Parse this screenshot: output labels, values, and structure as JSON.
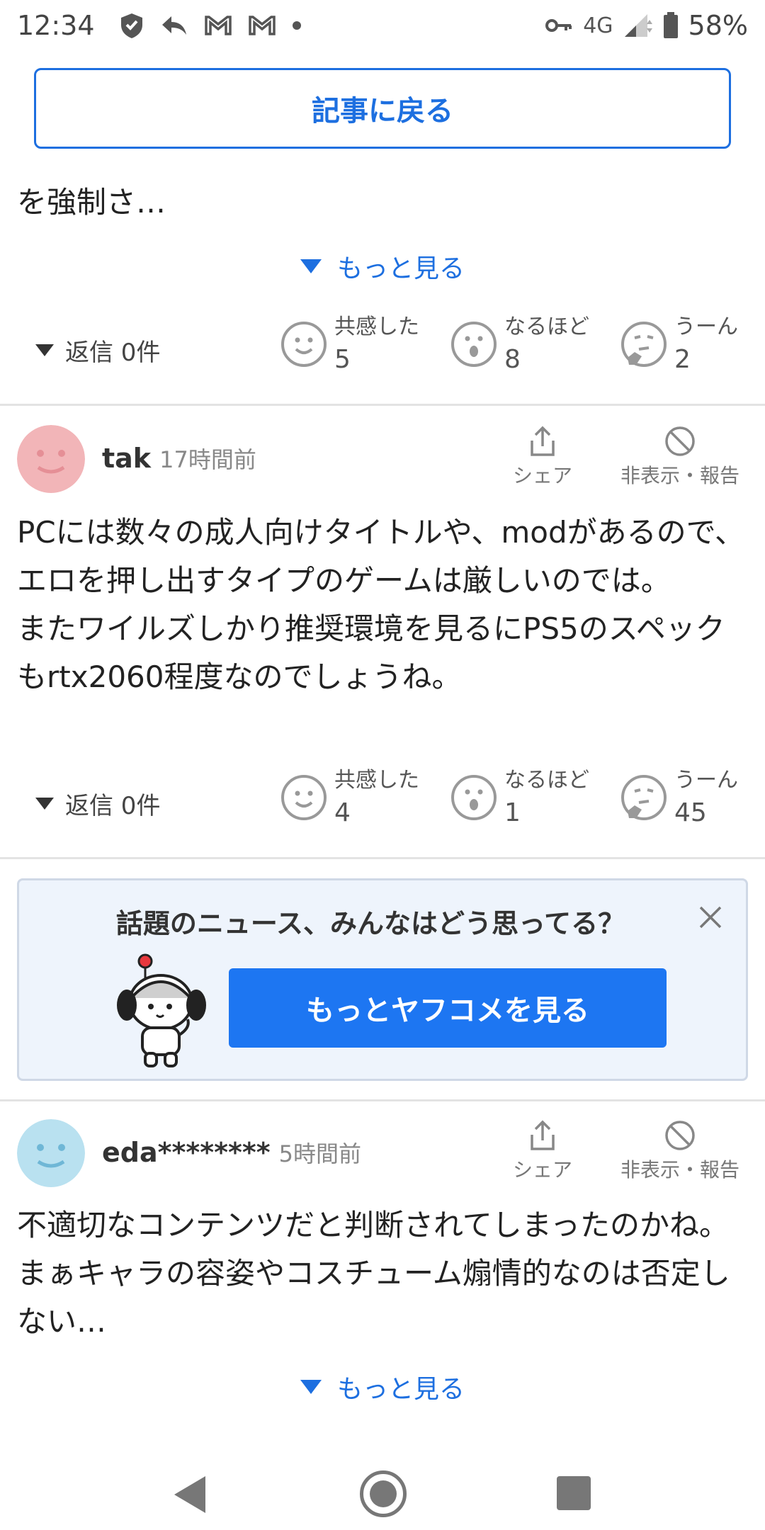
{
  "status_bar": {
    "time": "12:34",
    "network": "4G",
    "battery": "58%"
  },
  "back_button": {
    "label": "記事に戻る"
  },
  "comment1": {
    "text_tail": "を強制さ…",
    "more_label": "もっと見る",
    "reply_label": "返信 0件",
    "reactions": [
      {
        "label": "共感した",
        "count": "5"
      },
      {
        "label": "なるほど",
        "count": "8"
      },
      {
        "label": "うーん",
        "count": "2"
      }
    ]
  },
  "comment2": {
    "user": "tak",
    "time": "17時間前",
    "share_label": "シェア",
    "hide_label": "非表示・報告",
    "body": "PCには数々の成人向けタイトルや、modがあるので、エロを押し出すタイプのゲームは厳しいのでは。\nまたワイルズしかり推奨環境を見るにPS5のスペックもrtx2060程度なのでしょうね。",
    "reply_label": "返信 0件",
    "reactions": [
      {
        "label": "共感した",
        "count": "4"
      },
      {
        "label": "なるほど",
        "count": "1"
      },
      {
        "label": "うーん",
        "count": "45"
      }
    ]
  },
  "banner": {
    "title": "話題のニュース、みんなはどう思ってる？",
    "cta_label": "もっとヤフコメを見る"
  },
  "comment3": {
    "user": "eda********",
    "time": "5時間前",
    "share_label": "シェア",
    "hide_label": "非表示・報告",
    "body": "不適切なコンテンツだと判断されてしまったのかね。まぁキャラの容姿やコスチューム煽情的なのは否定しない…",
    "more_label": "もっと見る"
  },
  "colors": {
    "accent": "#1d6fe0",
    "cta": "#1d76f2",
    "avatar_tak": "#f2b5b8",
    "avatar_eda": "#b9e1f0"
  }
}
